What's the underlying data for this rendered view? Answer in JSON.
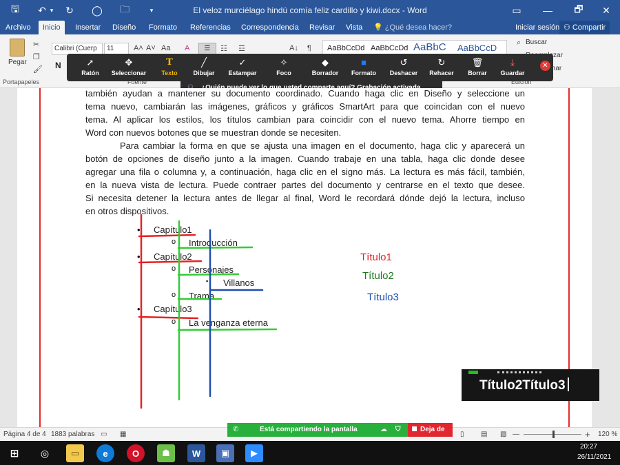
{
  "window": {
    "title": "El veloz murciélago hindú comía feliz cardillo y kiwi.docx - Word",
    "controls": {
      "ribbon_display": "▭",
      "minimize": "—",
      "maximize": "🗗",
      "close": "✕"
    }
  },
  "quick_access": {
    "save": "🖫",
    "undo": "↶",
    "undo_arrow": "▾",
    "redo": "↻",
    "circle": "◯",
    "folder": "🗀",
    "more": "▾"
  },
  "tabs": [
    {
      "label": "Archivo"
    },
    {
      "label": "Inicio",
      "active": true
    },
    {
      "label": "Insertar"
    },
    {
      "label": "Diseño"
    },
    {
      "label": "Formato"
    },
    {
      "label": "Referencias"
    },
    {
      "label": "Correspondencia"
    },
    {
      "label": "Revisar"
    },
    {
      "label": "Vista"
    }
  ],
  "tell_me": "💡 ¿Qué desea hacer?",
  "account": {
    "sign_in": "Iniciar sesión",
    "share": "Compartir"
  },
  "ribbon": {
    "paste_label": "Pegar",
    "bold": "N",
    "font_name": "Calibri (Cuerp",
    "font_size": "11",
    "grow": "A˄",
    "shrink": "A˅",
    "case": "Aa",
    "clear_format": "A",
    "para_mark": "¶",
    "sort": "A↓",
    "styles": [
      "AaBbCcDd",
      "AaBbCcDd",
      "AaBbC",
      "AaBbCcD"
    ],
    "search": "Buscar",
    "replace": "Reemplazar",
    "select": "Seleccionar",
    "groups": {
      "clipboard": "Portapapeles",
      "font": "Fuente",
      "editing": "Edición"
    }
  },
  "zoom_toolbar": {
    "tools": [
      {
        "label": "Ratón",
        "icon": "➚"
      },
      {
        "label": "Seleccionar",
        "icon": "✥"
      },
      {
        "label": "Texto",
        "icon": "T",
        "active": true
      },
      {
        "label": "Dibujar",
        "icon": "╱"
      },
      {
        "label": "Estampar",
        "icon": "✓"
      },
      {
        "label": "Foco",
        "icon": "✧"
      },
      {
        "label": "Borrador",
        "icon": "◆"
      },
      {
        "label": "Formato",
        "icon": "■"
      },
      {
        "label": "Deshacer",
        "icon": "↺"
      },
      {
        "label": "Rehacer",
        "icon": "↻"
      },
      {
        "label": "Borrar",
        "icon": "🗑"
      },
      {
        "label": "Guardar",
        "icon": "⤓"
      }
    ],
    "close": "✕",
    "banner": "¿Quién puede ver lo que usted comparte aquí? Grabación activada"
  },
  "document": {
    "para1_lines": [
      "también ayudan a mantener su documento coordinado. Cuando haga clic en Diseño y seleccione un",
      "tema nuevo, cambiarán las imágenes, gráficos y gráficos SmartArt para que coincidan con el nuevo",
      "tema. Al aplicar los estilos, los títulos cambian para coincidir con el nuevo tema. Ahorre tiempo en",
      "Word con nuevos botones que se muestran donde se necesiten."
    ],
    "para2_lines": [
      "Para cambiar la forma en que se ajusta una imagen en el documento, haga clic y aparecerá un",
      "botón de opciones de diseño junto a la imagen. Cuando trabaje en una tabla, haga clic donde desee",
      "agregar una fila o columna y, a continuación, haga clic en el signo más. La lectura es más fácil, también,",
      "en la nueva vista de lectura. Puede contraer partes del documento y centrarse en el texto que desee.",
      "Si necesita detener la lectura antes de llegar al final, Word le recordará dónde dejó la lectura, incluso",
      "en otros dispositivos."
    ],
    "outline": [
      {
        "text": "Capítulo1",
        "level": 1
      },
      {
        "text": "Introducción",
        "level": 2
      },
      {
        "text": "Capítulo2",
        "level": 1
      },
      {
        "text": "Personajes",
        "level": 2
      },
      {
        "text": "Villanos",
        "level": 3
      },
      {
        "text": "Trama",
        "level": 2
      },
      {
        "text": "Capítulo3",
        "level": 1
      },
      {
        "text": "La venganza eterna",
        "level": 2
      }
    ],
    "bullets": {
      "level1": "•",
      "level2": "o",
      "level3": "▪"
    },
    "legend": [
      {
        "text": "Título1",
        "color": "#e62222"
      },
      {
        "text": "Título2",
        "color": "#1e7a1e"
      },
      {
        "text": "Título3",
        "color": "#1f4fb0"
      }
    ],
    "annotation_colors": {
      "red": "#e62222",
      "green": "#33cc33",
      "blue": "#1f4fb0"
    },
    "typed_text": "Título2Título3"
  },
  "statusbar": {
    "page": "Página 4 de 4",
    "words": "1883 palabras",
    "zoom": "120 %",
    "zoom_minus": "—",
    "zoom_plus": "+"
  },
  "sharing": {
    "label": "Está compartiendo la pantalla",
    "stop": "Deja de"
  },
  "taskbar": {
    "time": "20:27",
    "date": "26/11/2021",
    "word_label": "W",
    "opera_label": "O",
    "zoom_label": "▶"
  }
}
